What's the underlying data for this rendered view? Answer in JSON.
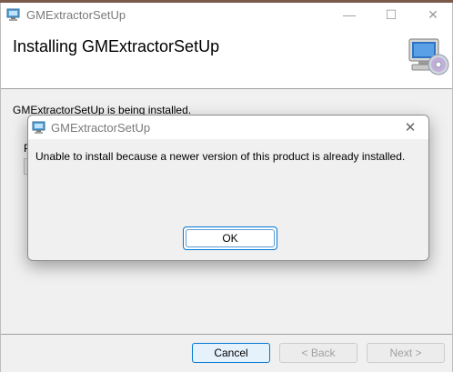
{
  "window": {
    "title": "GMExtractorSetUp",
    "min_glyph": "—",
    "max_glyph": "☐",
    "close_glyph": "✕"
  },
  "header": {
    "title": "Installing GMExtractorSetUp",
    "graphic_icon": "computer-cd-icon"
  },
  "main": {
    "status_text": "GMExtractorSetUp is being installed.",
    "progress_label": "P",
    "progress_fraction": 0
  },
  "footer": {
    "cancel_label": "Cancel",
    "back_label": "< Back",
    "next_label": "Next >"
  },
  "dialog": {
    "title": "GMExtractorSetUp",
    "message": "Unable to install because a newer version of this product is already installed.",
    "ok_label": "OK",
    "close_glyph": "✕"
  },
  "colors": {
    "accent": "#0078d4",
    "title_text": "#7a7a7a"
  }
}
